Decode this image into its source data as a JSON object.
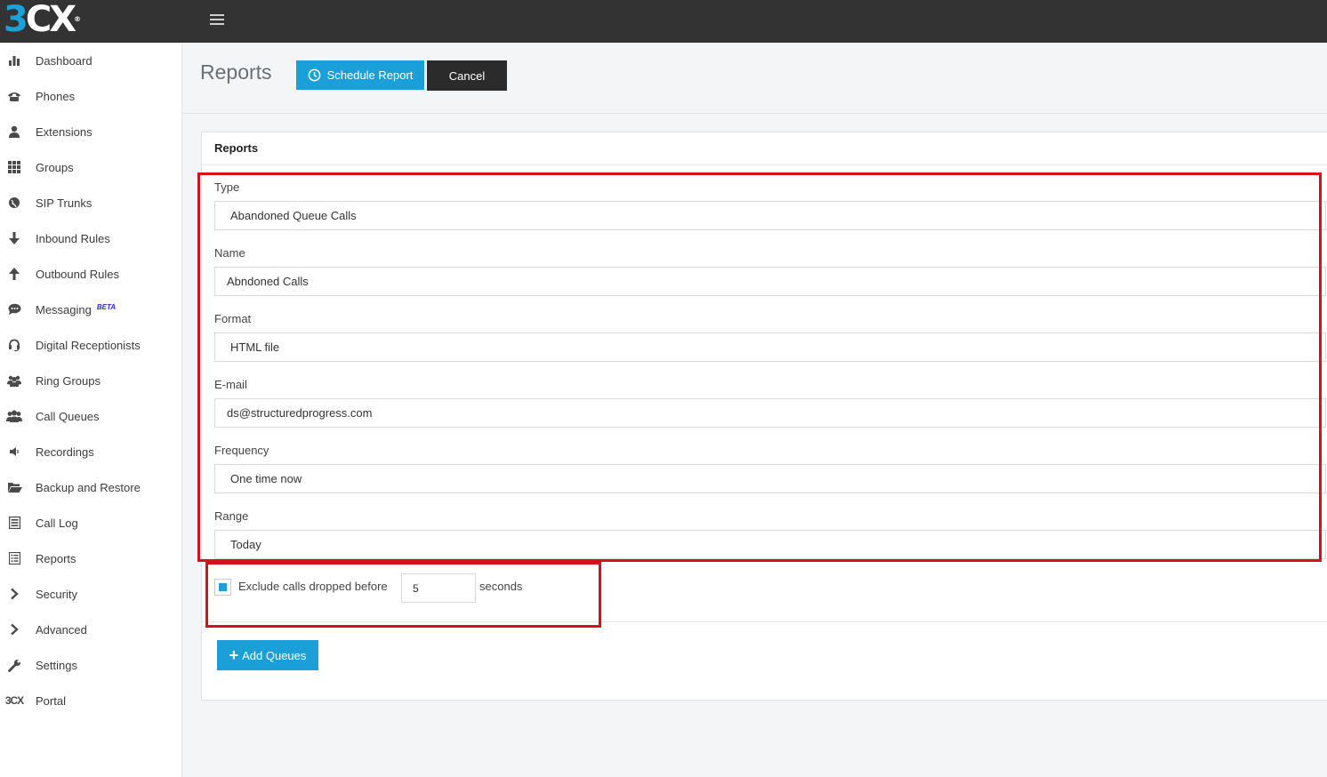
{
  "app": {
    "logo_main": "3",
    "logo_rest": "CX",
    "logo_reg": "®"
  },
  "sidebar": {
    "items": [
      {
        "label": "Dashboard",
        "icon": "bar-chart-icon"
      },
      {
        "label": "Phones",
        "icon": "phone-icon"
      },
      {
        "label": "Extensions",
        "icon": "user-icon"
      },
      {
        "label": "Groups",
        "icon": "grid-icon"
      },
      {
        "label": "SIP Trunks",
        "icon": "globe-icon"
      },
      {
        "label": "Inbound Rules",
        "icon": "arrow-down-icon"
      },
      {
        "label": "Outbound Rules",
        "icon": "arrow-up-icon"
      },
      {
        "label": "Messaging",
        "icon": "chat-icon",
        "badge": "BETA"
      },
      {
        "label": "Digital Receptionists",
        "icon": "headset-icon"
      },
      {
        "label": "Ring Groups",
        "icon": "users-icon"
      },
      {
        "label": "Call Queues",
        "icon": "group-icon"
      },
      {
        "label": "Recordings",
        "icon": "speaker-icon"
      },
      {
        "label": "Backup and Restore",
        "icon": "folder-open-icon"
      },
      {
        "label": "Call Log",
        "icon": "list-icon"
      },
      {
        "label": "Reports",
        "icon": "report-icon"
      },
      {
        "label": "Security",
        "icon": "chevron-right-icon"
      },
      {
        "label": "Advanced",
        "icon": "chevron-right-icon"
      },
      {
        "label": "Settings",
        "icon": "wrench-icon"
      },
      {
        "label": "Portal",
        "icon": "3cx-logo-icon",
        "icon_text": "3CX"
      }
    ]
  },
  "header": {
    "title": "Reports",
    "schedule_label": "Schedule Report",
    "cancel_label": "Cancel"
  },
  "panel": {
    "title": "Reports",
    "fields": [
      {
        "label": "Type",
        "value": "Abandoned Queue Calls"
      },
      {
        "label": "Name",
        "value": "Abndoned Calls"
      },
      {
        "label": "Format",
        "value": "HTML file"
      },
      {
        "label": "E-mail",
        "value": "ds@structuredprogress.com"
      },
      {
        "label": "Frequency",
        "value": "One time now"
      },
      {
        "label": "Range",
        "value": "Today"
      }
    ],
    "exclude": {
      "checked": true,
      "label": "Exclude calls dropped before",
      "value": "5",
      "unit": "seconds"
    },
    "add_queues_label": "Add Queues"
  },
  "colors": {
    "accent": "#1a9fd9",
    "topbar": "#333333",
    "highlight": "#d5121c"
  }
}
